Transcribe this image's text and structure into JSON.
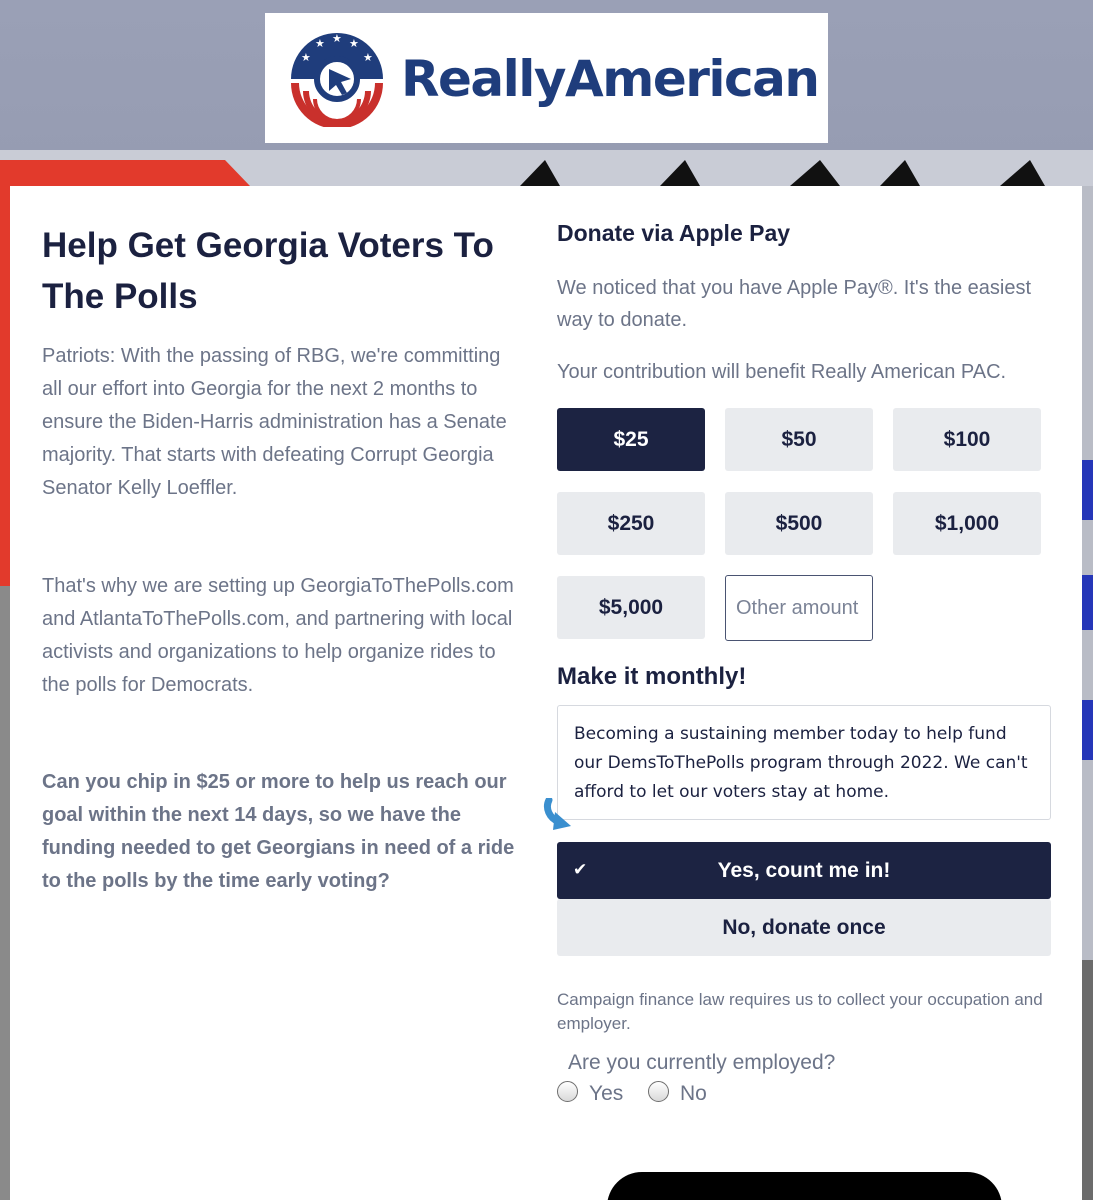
{
  "brand": {
    "name": "ReallyAmerican",
    "colors": {
      "navy": "#1f3d7c",
      "red": "#c9302c",
      "dark_navy": "#1c2342"
    }
  },
  "intro": {
    "headline": "Help Get Georgia Voters To The Polls",
    "paragraph1": "Patriots: With the passing of RBG, we're committing all our effort into Georgia for the next 2 months to ensure the Biden-Harris administration has a Senate majority. That starts with defeating Corrupt Georgia Senator Kelly Loeffler.",
    "paragraph2": "That's why we are setting up GeorgiaToThePolls.com and AtlantaToThePolls.com, and partnering with local activists and organizations to help organize rides to the polls for Democrats.",
    "ask": "Can you chip in $25 or more to help us reach our goal within the next 14 days, so we have the funding needed to get Georgians in need of a ride to the polls by the time early voting?"
  },
  "donate": {
    "title": "Donate via Apple Pay",
    "notice": "We noticed that you have Apple Pay®. It's the easiest way to donate.",
    "benefit": "Your contribution will benefit Really American PAC.",
    "amounts": [
      "$25",
      "$50",
      "$100",
      "$250",
      "$500",
      "$1,000",
      "$5,000"
    ],
    "selected_amount": "$25",
    "other_placeholder": "Other amount"
  },
  "monthly": {
    "title": "Make it monthly!",
    "text": "Becoming a sustaining member today to help fund our DemsToThePolls program through 2022. We can't afford to let our voters stay at home.",
    "yes_label": "Yes, count me in!",
    "no_label": "No, donate once",
    "selected": "yes"
  },
  "employment": {
    "note": "Campaign finance law requires us to collect your occupation and employer.",
    "question": "Are you currently employed?",
    "options": [
      "Yes",
      "No"
    ]
  }
}
